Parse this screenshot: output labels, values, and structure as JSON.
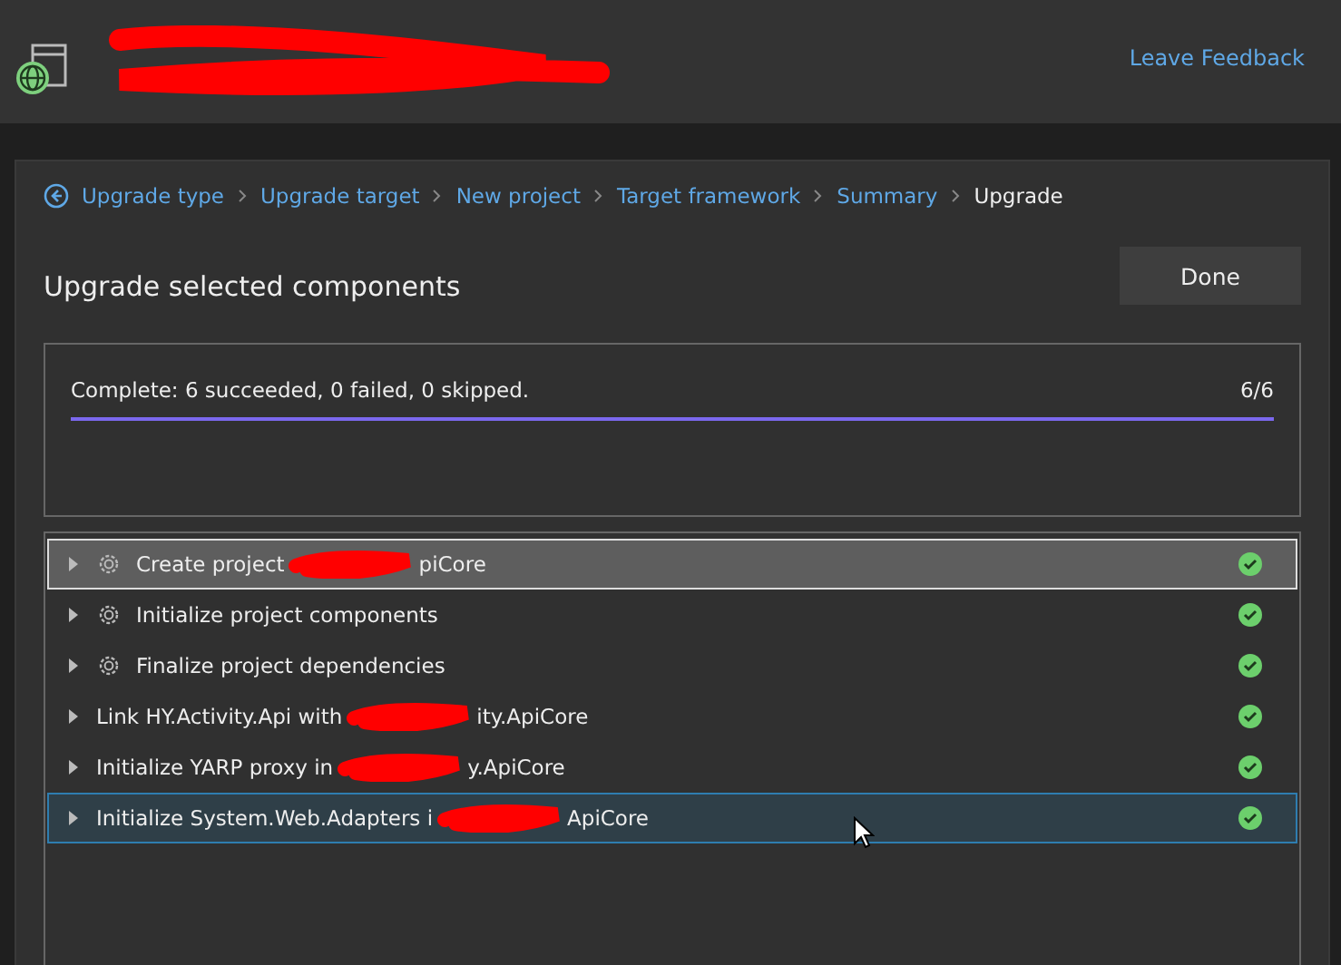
{
  "header": {
    "redacted": true,
    "link": "Leave Feedback"
  },
  "breadcrumb": [
    {
      "label": "Upgrade type",
      "selected": false
    },
    {
      "label": "Upgrade target",
      "selected": false
    },
    {
      "label": "New project",
      "selected": false
    },
    {
      "label": "Target framework",
      "selected": false
    },
    {
      "label": "Summary",
      "selected": false
    },
    {
      "label": "Upgrade",
      "selected": true
    }
  ],
  "title": "Upgrade selected components",
  "done_button": "Done",
  "progress": {
    "message": "Complete: 6 succeeded, 0 failed, 0 skipped.",
    "count": "6/6",
    "level": 1
  },
  "steps": [
    {
      "kind": "gear",
      "before": "Create project",
      "after": "piCore",
      "redacted": true,
      "focused": true,
      "selected": false,
      "succeeded": true
    },
    {
      "kind": "gear",
      "before": "Initialize project components",
      "redacted": false,
      "focused": false,
      "selected": false,
      "succeeded": true
    },
    {
      "kind": "gear",
      "before": "Finalize project dependencies",
      "redacted": false,
      "focused": false,
      "selected": false,
      "succeeded": true
    },
    {
      "kind": "plain",
      "before": "Link HY.Activity.Api with",
      "after": "ity.ApiCore",
      "redacted": true,
      "focused": false,
      "selected": false,
      "succeeded": true
    },
    {
      "kind": "plain",
      "before": "Initialize YARP proxy in",
      "after": "y.ApiCore",
      "redacted": true,
      "focused": false,
      "selected": false,
      "succeeded": true
    },
    {
      "kind": "plain",
      "before": "Initialize System.Web.Adapters i",
      "after": "ApiCore",
      "redacted": true,
      "focused": false,
      "selected": true,
      "succeeded": true
    }
  ]
}
